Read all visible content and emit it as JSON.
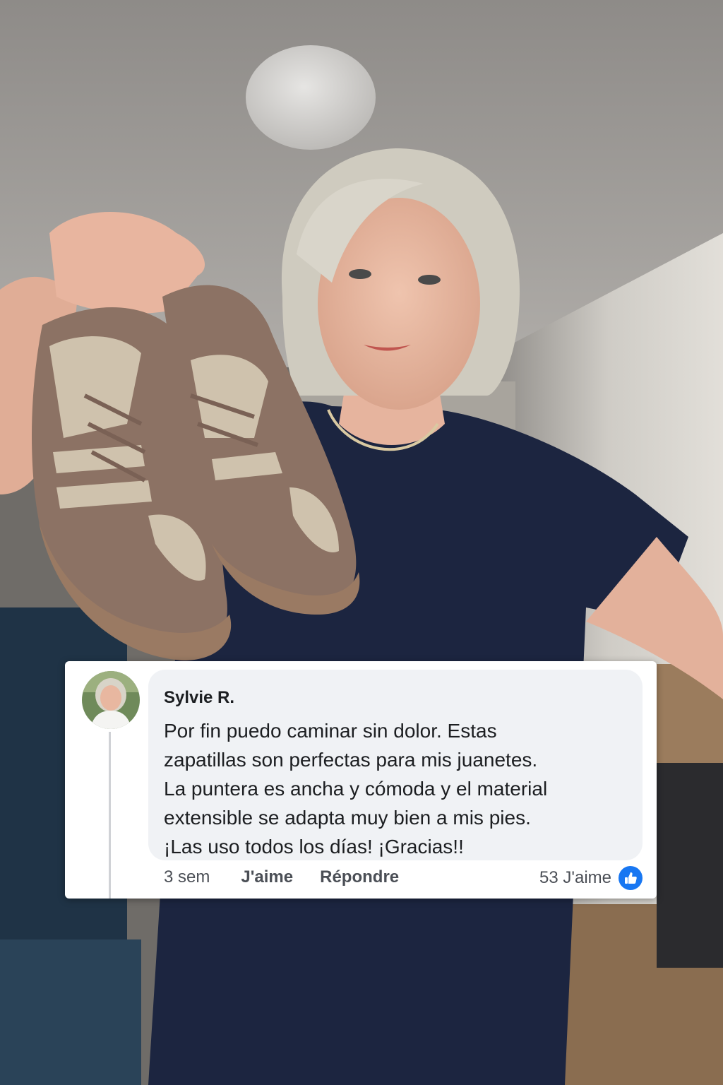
{
  "photo": {
    "description_icons": [
      "ceiling-light-icon",
      "sneakers-icon"
    ],
    "colors": {
      "ceiling": "#a9a6a2",
      "wall": "#d8d5cf",
      "tshirt": "#1c2540",
      "sneaker_knit": "#8c7264",
      "sneaker_pattern": "#cfc2ad",
      "sole": "#9a7a63",
      "hair": "#cfcbbf",
      "skin": "#e9b9a3"
    }
  },
  "comment": {
    "author": "Sylvie R.",
    "lines": [
      "Por fin puedo caminar sin dolor. Estas",
      "zapatillas son perfectas para mis juanetes.",
      "La puntera es ancha y cómoda y el material",
      "extensible se adapta muy bien a mis pies.",
      "¡Las uso todos los días! ¡Gracias!!"
    ],
    "time": "3 sem",
    "like_label": "J'aime",
    "reply_label": "Répondre",
    "like_count_label": "53 J'aime",
    "like_icon": "thumbs-up-icon",
    "accent_color": "#1877f2"
  }
}
